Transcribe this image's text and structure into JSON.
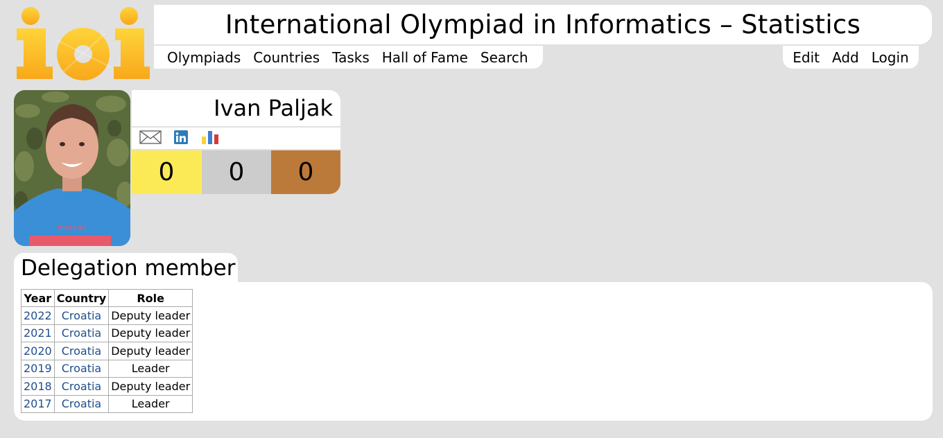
{
  "colors": {
    "gold": "#fce956",
    "silver": "#cccccc",
    "bronze": "#bb7a3a",
    "link": "#1f4e8c",
    "logo_yellow": "#fdb913"
  },
  "header": {
    "logo_alt": "ioi",
    "title": "International Olympiad in Informatics – Statistics"
  },
  "nav": {
    "left": [
      "Olympiads",
      "Countries",
      "Tasks",
      "Hall of Fame",
      "Search"
    ],
    "right": [
      "Edit",
      "Add",
      "Login"
    ]
  },
  "person": {
    "name": "Ivan Paljak",
    "icons": [
      "mail-icon",
      "linkedin-icon",
      "stats-icon"
    ],
    "medals": {
      "gold": "0",
      "silver": "0",
      "bronze": "0"
    }
  },
  "delegation": {
    "heading": "Delegation member",
    "columns": [
      "Year",
      "Country",
      "Role"
    ],
    "rows": [
      [
        "2022",
        "Croatia",
        "Deputy leader"
      ],
      [
        "2021",
        "Croatia",
        "Deputy leader"
      ],
      [
        "2020",
        "Croatia",
        "Deputy leader"
      ],
      [
        "2019",
        "Croatia",
        "Leader"
      ],
      [
        "2018",
        "Croatia",
        "Deputy leader"
      ],
      [
        "2017",
        "Croatia",
        "Leader"
      ]
    ]
  }
}
